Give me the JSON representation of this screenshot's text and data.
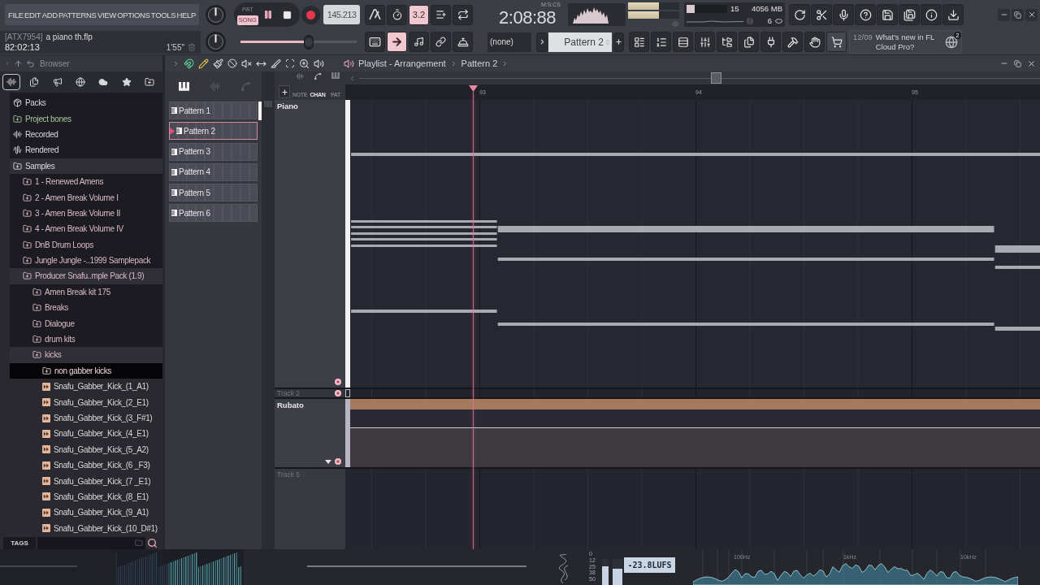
{
  "menu": [
    "FILE",
    "EDIT",
    "ADD",
    "PATTERNS",
    "VIEW",
    "OPTIONS",
    "TOOLS",
    "HELP"
  ],
  "transport": {
    "modes": [
      {
        "label": "PAT",
        "selected": false
      },
      {
        "label": "SONG",
        "selected": true
      }
    ],
    "tempo": "145.213"
  },
  "toolbar_top": [
    {
      "kind": "metronome",
      "on": false
    },
    {
      "kind": "timer",
      "on": false
    },
    {
      "kind": "countdown",
      "label": "3.2",
      "on": true
    },
    {
      "kind": "step-edit",
      "on": false
    },
    {
      "kind": "loop",
      "on": false
    }
  ],
  "time": {
    "unit": "M:S:CS",
    "value": "2:08:88"
  },
  "output_meter": [
    {
      "level": 0.6
    },
    {
      "level": 0.6
    }
  ],
  "performance": {
    "cpu_meter": {
      "level": 0.19
    },
    "cpu": "15",
    "memory": "4056 MB",
    "voices": "6"
  },
  "project": {
    "tag": "[ATX7954]",
    "name": "a piano th.flp",
    "position": "82:02:13",
    "length": "1'55\""
  },
  "pitch_slider": {
    "level": 0.59
  },
  "toolbar_bottom": [
    {
      "kind": "keyboard",
      "on": false
    },
    {
      "kind": "arrow",
      "on": true
    },
    {
      "kind": "note",
      "on": false
    },
    {
      "kind": "link",
      "on": false
    },
    {
      "kind": "bell",
      "on": false
    }
  ],
  "snap": "(none)",
  "pattern_selector": "Pattern 2",
  "news": {
    "date": "12/09",
    "text": "What's new in FL Cloud Pro?",
    "badge": "2"
  },
  "browser": {
    "title": "Browser",
    "tabs": [
      {
        "kind": "all",
        "selected": true
      },
      {
        "kind": "files",
        "selected": false
      },
      {
        "kind": "plugins",
        "selected": false
      },
      {
        "kind": "online",
        "selected": false
      },
      {
        "kind": "cloud",
        "selected": false
      },
      {
        "kind": "favorites",
        "selected": false
      },
      {
        "kind": "folders",
        "selected": false
      }
    ],
    "tree": [
      {
        "label": "Packs",
        "kind": "pack",
        "expanded": false,
        "selected": false
      },
      {
        "label": "Project bones",
        "kind": "project",
        "expanded": false,
        "selected": false
      },
      {
        "label": "Recorded",
        "kind": "recorded",
        "expanded": false,
        "selected": false
      },
      {
        "label": "Rendered",
        "kind": "rendered",
        "expanded": false,
        "selected": false
      },
      {
        "label": "Samples",
        "kind": "folder",
        "expanded": true,
        "selected": false,
        "children": [
          {
            "label": "1 - Renewed Amens",
            "kind": "folder",
            "expanded": false,
            "selected": false
          },
          {
            "label": "2 - Amen Break Volume I",
            "kind": "folder",
            "expanded": false,
            "selected": false
          },
          {
            "label": "3 - Amen Break Volume II",
            "kind": "folder",
            "expanded": false,
            "selected": false
          },
          {
            "label": "4 - Amen Break Volume IV",
            "kind": "folder",
            "expanded": false,
            "selected": false
          },
          {
            "label": "DnB Drum Loops",
            "kind": "folder",
            "expanded": false,
            "selected": false
          },
          {
            "label": "Jungle Jungle -..1999 Samplepack",
            "kind": "folder",
            "expanded": false,
            "selected": false
          },
          {
            "label": "Producer Snafu..mple Pack (1.9)",
            "kind": "folder",
            "expanded": true,
            "selected": false,
            "children": [
              {
                "label": "Amen Break kit 175",
                "kind": "folder",
                "expanded": false,
                "selected": false
              },
              {
                "label": "Breaks",
                "kind": "folder",
                "expanded": false,
                "selected": false
              },
              {
                "label": "Dialogue",
                "kind": "folder",
                "expanded": false,
                "selected": false
              },
              {
                "label": "drum kits",
                "kind": "folder",
                "expanded": false,
                "selected": false
              },
              {
                "label": "kicks",
                "kind": "folder",
                "expanded": true,
                "selected": false,
                "children": [
                  {
                    "label": "non gabber kicks",
                    "kind": "folder",
                    "expanded": false,
                    "selected": true
                  },
                  {
                    "label": "Snafu_Gabber_Kick_(1_A1)",
                    "kind": "file",
                    "selected": false
                  },
                  {
                    "label": "Snafu_Gabber_Kick_(2_E1)",
                    "kind": "file",
                    "selected": false
                  },
                  {
                    "label": "Snafu_Gabber_Kick_(3_F#1)",
                    "kind": "file",
                    "selected": false
                  },
                  {
                    "label": "Snafu_Gabber_Kick_(4_E1)",
                    "kind": "file",
                    "selected": false
                  },
                  {
                    "label": "Snafu_Gabber_Kick_(5_A2)",
                    "kind": "file",
                    "selected": false
                  },
                  {
                    "label": "Snafu_Gabber_Kick_(6 _F3)",
                    "kind": "file",
                    "selected": false
                  },
                  {
                    "label": "Snafu_Gabber_Kick_(7 _E1)",
                    "kind": "file",
                    "selected": false
                  },
                  {
                    "label": "Snafu_Gabber_Kick_(8_E1)",
                    "kind": "file",
                    "selected": false
                  },
                  {
                    "label": "Snafu_Gabber_Kick_(9_A1)",
                    "kind": "file",
                    "selected": false
                  },
                  {
                    "label": "Snafu_Gabber_Kick_(10_D#1)",
                    "kind": "file",
                    "selected": false
                  }
                ]
              }
            ]
          }
        ]
      }
    ],
    "tags": "TAGS"
  },
  "playlist": {
    "title": "Playlist - Arrangement",
    "pattern": "Pattern 2",
    "modes": [
      {
        "kind": "note",
        "label": "NOTE",
        "selected": false
      },
      {
        "kind": "channel",
        "label": "CHAN",
        "selected": true
      },
      {
        "kind": "pattern",
        "label": "PAT",
        "selected": false
      }
    ],
    "patterns": [
      {
        "name": "Pattern 1",
        "selected": false
      },
      {
        "name": "Pattern 2",
        "selected": true
      },
      {
        "name": "Pattern 3",
        "selected": false
      },
      {
        "name": "Pattern 4",
        "selected": false
      },
      {
        "name": "Pattern 5",
        "selected": false
      },
      {
        "name": "Pattern 6",
        "selected": false
      }
    ],
    "ruler": [
      "93",
      "94",
      "95"
    ],
    "tracks": [
      {
        "name": "Piano",
        "kind": "pattern"
      },
      {
        "name": "Track 2",
        "kind": "collapsed"
      },
      {
        "name": "Rubato",
        "kind": "automation"
      },
      {
        "name": "Track 5",
        "kind": "empty"
      }
    ]
  },
  "visualizer": {
    "meter_scale": [
      "0",
      "12",
      "25",
      "38",
      "50"
    ],
    "meters": [
      {
        "level": 0.71
      },
      {
        "level": 0.63
      }
    ],
    "loudness": "-23.8LUFS",
    "frequencies": [
      "100Hz",
      "1kHz",
      "10kHz"
    ]
  }
}
